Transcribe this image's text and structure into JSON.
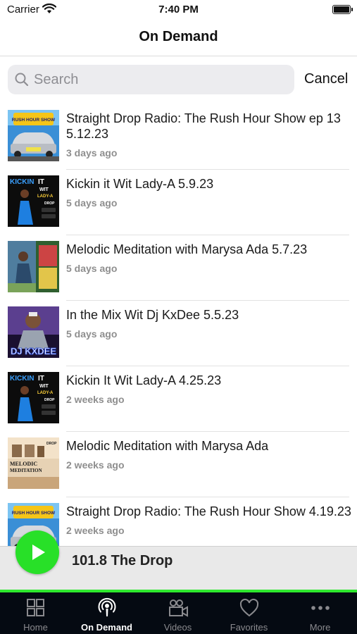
{
  "status_bar": {
    "carrier": "Carrier",
    "time": "7:40 PM"
  },
  "nav": {
    "title": "On Demand"
  },
  "search": {
    "placeholder": "Search",
    "value": "",
    "cancel_label": "Cancel"
  },
  "episodes": [
    {
      "title": "Straight Drop Radio: The Rush Hour Show ep 13 5.12.23",
      "subtitle": "3 days ago",
      "thumb": "rush-hour"
    },
    {
      "title": "Kickin it Wit Lady-A 5.9.23",
      "subtitle": "5 days ago",
      "thumb": "kickin"
    },
    {
      "title": "Melodic Meditation with Marysa Ada 5.7.23",
      "subtitle": "5 days ago",
      "thumb": "melodic-a"
    },
    {
      "title": "In the Mix Wit Dj KxDee 5.5.23",
      "subtitle": "5 days ago",
      "thumb": "kxdee"
    },
    {
      "title": "Kickin It Wit Lady-A 4.25.23",
      "subtitle": "2 weeks ago",
      "thumb": "kickin"
    },
    {
      "title": "Melodic Meditation with Marysa Ada",
      "subtitle": "2 weeks ago",
      "thumb": "melodic-b"
    },
    {
      "title": "Straight Drop Radio: The Rush Hour Show 4.19.23",
      "subtitle": "2 weeks ago",
      "thumb": "rush-hour"
    }
  ],
  "thumb_text": {
    "rush_hour": "RUSH HOUR SHOW",
    "kickin": "KICKIN",
    "kickin_it": "IT",
    "kickin_wit": "WIT",
    "kickin_lady": "LADY-A",
    "drop": "DROP",
    "kxdee": "DJ KXDEE",
    "melodic": "MELODIC",
    "meditation": "MEDITATION"
  },
  "now_playing": {
    "station": "101.8 The Drop"
  },
  "tabs": [
    {
      "label": "Home",
      "icon": "grid-icon",
      "active": false
    },
    {
      "label": "On Demand",
      "icon": "podcast-icon",
      "active": true
    },
    {
      "label": "Videos",
      "icon": "video-camera-icon",
      "active": false
    },
    {
      "label": "Favorites",
      "icon": "heart-icon",
      "active": false
    },
    {
      "label": "More",
      "icon": "ellipsis-icon",
      "active": false
    }
  ],
  "colors": {
    "accent_green": "#28e028",
    "tab_bar_bg": "#050a12",
    "tab_active": "#ffffff",
    "tab_inactive": "#8a8a8e"
  }
}
